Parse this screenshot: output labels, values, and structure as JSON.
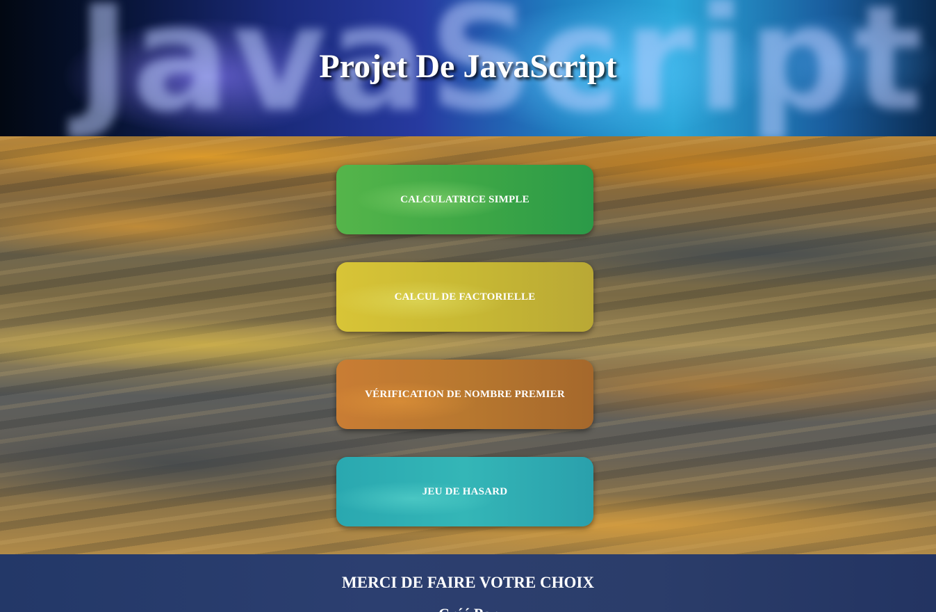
{
  "header": {
    "banner_word": "JavaScript",
    "title": "Projet De JavaScript"
  },
  "menu": {
    "items": [
      {
        "label": "CALCULATRICE SIMPLE",
        "color": "#3fa846"
      },
      {
        "label": "CALCUL DE FACTORIELLE",
        "color": "#c8b934"
      },
      {
        "label": "VÉRIFICATION DE NOMBRE PREMIER",
        "color": "#b8782f"
      },
      {
        "label": "JEU DE HASARD",
        "color": "#34b6b7"
      }
    ]
  },
  "footer": {
    "message": "MERCI DE FAIRE VOTRE CHOIX",
    "credit": "Créé Par"
  }
}
